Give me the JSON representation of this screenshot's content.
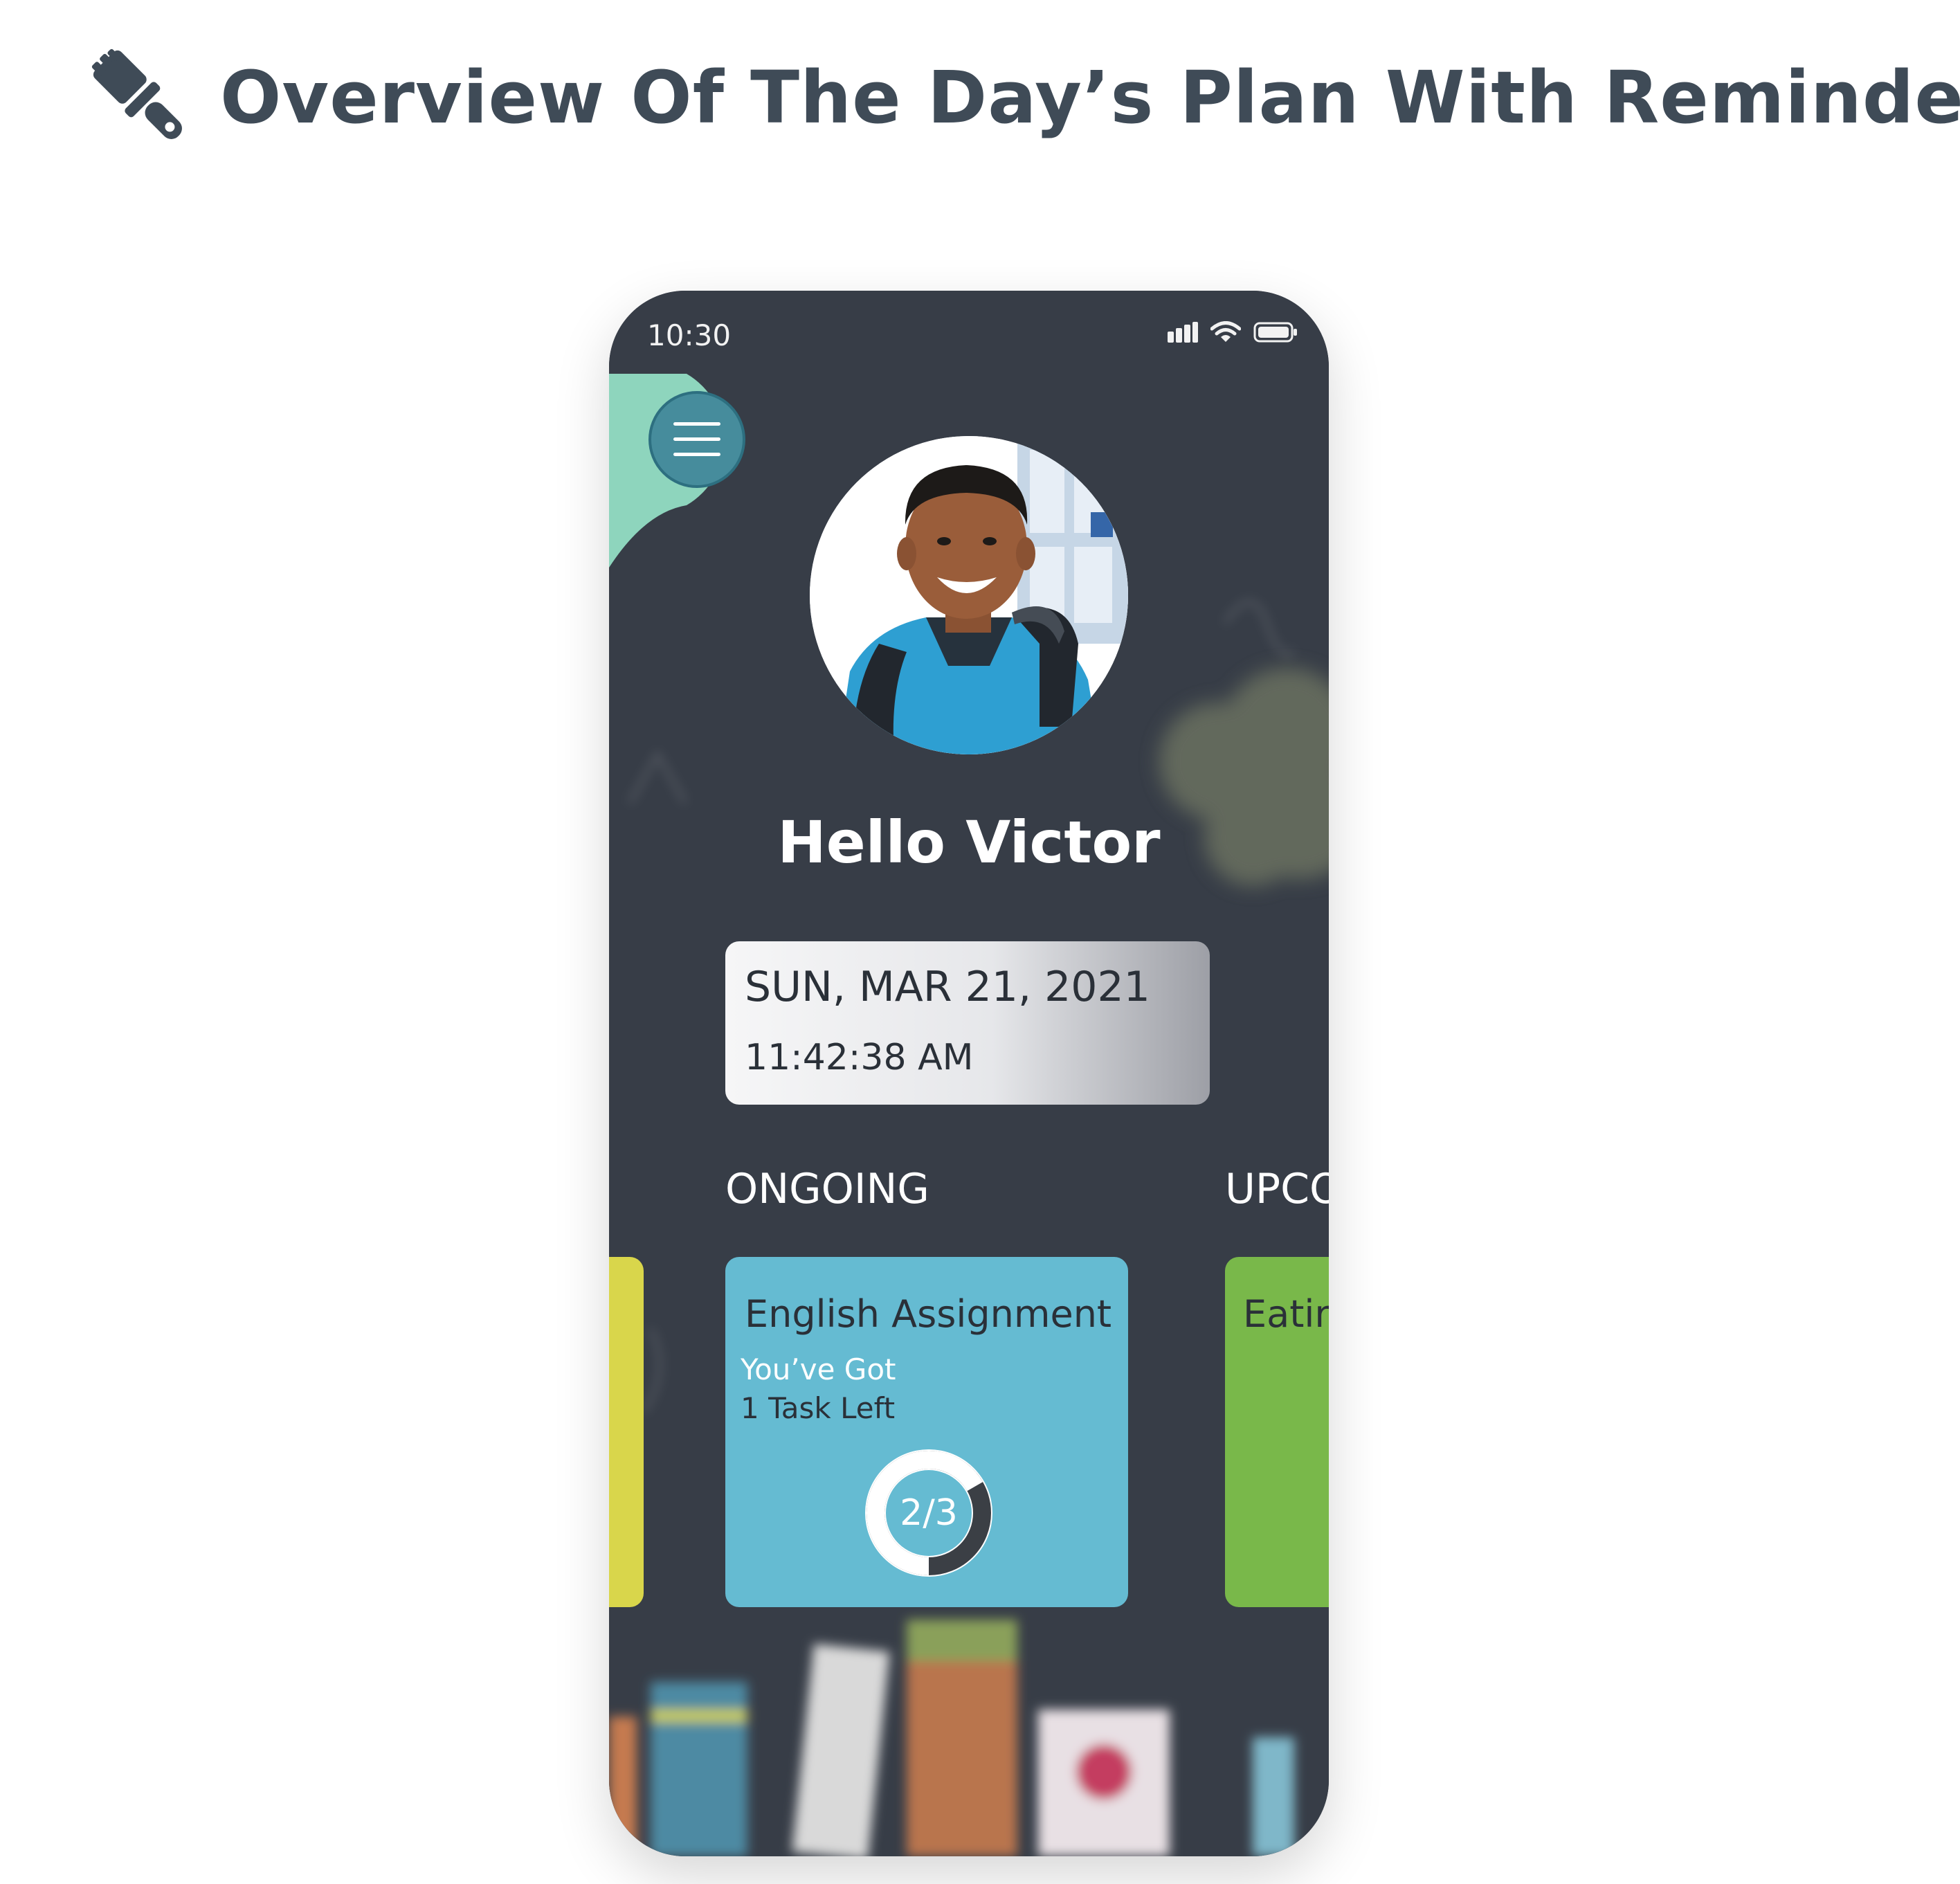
{
  "page": {
    "title": "Overview Of The Day’s Plan With Reminder",
    "icon": "paintbrush-icon"
  },
  "phone": {
    "status_bar": {
      "time": "10:30",
      "icons": [
        "signal-icon",
        "wifi-icon",
        "battery-icon"
      ]
    },
    "menu": {
      "icon": "hamburger-menu-icon"
    },
    "greeting": "Hello Victor",
    "datetime": {
      "date": "SUN, MAR 21, 2021",
      "time": "11:42:38 AM"
    },
    "sections": {
      "ongoing": "ONGOING",
      "upcoming": "UPCO"
    },
    "ongoing_task": {
      "title": "English Assignment",
      "subtitle_line1": "You’ve Got",
      "subtitle_line2": "1 Task Left",
      "progress_label": "2/3",
      "progress_fraction": 0.6667
    },
    "upcoming_task": {
      "title": "Eatir"
    }
  },
  "colors": {
    "phone_bg": "#373d47",
    "menu_bubble": "#8ed5bd",
    "menu_button": "#468c9c",
    "card_ongoing": "#65bbd2",
    "card_upcoming": "#79b84a",
    "card_previous": "#d9d64b",
    "title_text": "#3f4b57"
  }
}
